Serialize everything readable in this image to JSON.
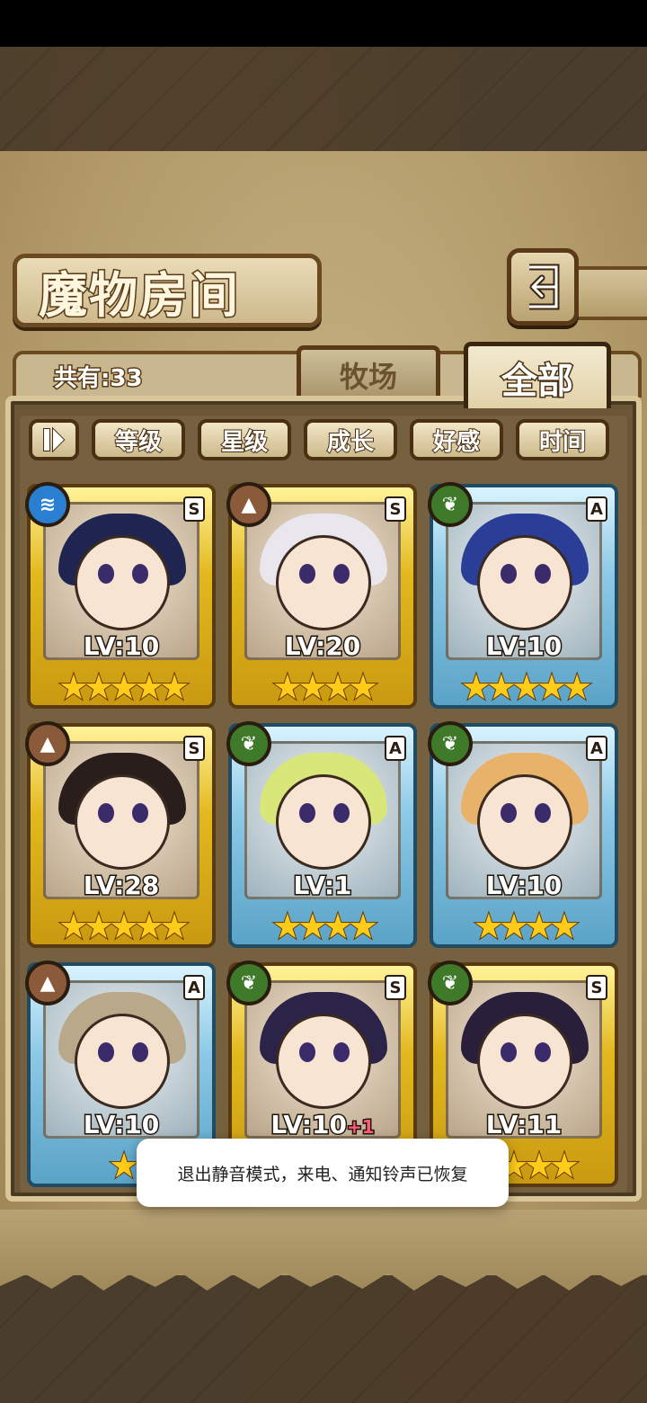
{
  "screen": {
    "title": "魔物房间",
    "total_label": "共有:33"
  },
  "tabs": [
    {
      "label": "牧场",
      "active": false
    },
    {
      "label": "全部",
      "active": true
    }
  ],
  "filters": [
    "等级",
    "星级",
    "成长",
    "好感",
    "时间"
  ],
  "sort_icon": "sort-toggle-icon",
  "colors": {
    "gold_frame": "#e3b81e",
    "blue_frame": "#8dc9e6",
    "water": "#2a7fd0",
    "earth": "#8a5a3a",
    "wood": "#3e7a2a"
  },
  "monsters": [
    {
      "level": "LV:10",
      "bonus": "",
      "rank": "S",
      "attribute": "water",
      "stars": 5,
      "frame": "gold",
      "hair": "#1f2550"
    },
    {
      "level": "LV:20",
      "bonus": "",
      "rank": "S",
      "attribute": "earth",
      "stars": 4,
      "frame": "gold",
      "hair": "#e9e6ee"
    },
    {
      "level": "LV:10",
      "bonus": "",
      "rank": "A",
      "attribute": "wood",
      "stars": 5,
      "frame": "blue",
      "hair": "#2a3e98"
    },
    {
      "level": "LV:28",
      "bonus": "",
      "rank": "S",
      "attribute": "earth",
      "stars": 5,
      "frame": "gold",
      "hair": "#2a1e1c"
    },
    {
      "level": "LV:1",
      "bonus": "",
      "rank": "A",
      "attribute": "wood",
      "stars": 4,
      "frame": "blue",
      "hair": "#d9e67a"
    },
    {
      "level": "LV:10",
      "bonus": "",
      "rank": "A",
      "attribute": "wood",
      "stars": 4,
      "frame": "blue",
      "hair": "#e8b26a"
    },
    {
      "level": "LV:10",
      "bonus": "",
      "rank": "A",
      "attribute": "earth",
      "stars": 1,
      "frame": "blue",
      "hair": "#b9a98a"
    },
    {
      "level": "LV:10",
      "bonus": "+1",
      "rank": "S",
      "attribute": "wood",
      "stars": 4,
      "frame": "gold",
      "hair": "#2c2448"
    },
    {
      "level": "LV:11",
      "bonus": "",
      "rank": "S",
      "attribute": "wood",
      "stars": 4,
      "frame": "gold",
      "hair": "#2a1f3a"
    }
  ],
  "toast": "退出静音模式，来电、通知铃声已恢复"
}
